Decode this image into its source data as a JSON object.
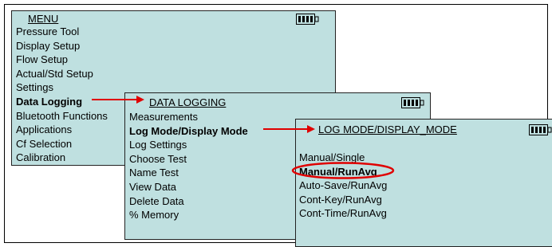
{
  "menu_main": {
    "title": "MENU",
    "items": [
      {
        "label": "Pressure Tool",
        "bold": false
      },
      {
        "label": "Display Setup",
        "bold": false
      },
      {
        "label": "Flow Setup",
        "bold": false
      },
      {
        "label": "Actual/Std Setup",
        "bold": false
      },
      {
        "label": "Settings",
        "bold": false
      },
      {
        "label": "Data Logging",
        "bold": true
      },
      {
        "label": "Bluetooth Functions",
        "bold": false
      },
      {
        "label": "Applications",
        "bold": false
      },
      {
        "label": "Cf Selection",
        "bold": false
      },
      {
        "label": "Calibration",
        "bold": false
      }
    ]
  },
  "menu_data_logging": {
    "title": "DATA LOGGING",
    "items": [
      {
        "label": "Measurements",
        "bold": false
      },
      {
        "label": "Log Mode/Display Mode",
        "bold": true
      },
      {
        "label": "Log Settings",
        "bold": false
      },
      {
        "label": "Choose Test",
        "bold": false
      },
      {
        "label": "Name Test",
        "bold": false
      },
      {
        "label": "View Data",
        "bold": false
      },
      {
        "label": "Delete Data",
        "bold": false
      },
      {
        "label": "% Memory",
        "bold": false
      }
    ]
  },
  "menu_log_mode": {
    "title": "LOG MODE/DISPLAY_MODE",
    "items": [
      {
        "label": "Manual/Single",
        "bold": false
      },
      {
        "label": "Manual/RunAvg",
        "bold": true,
        "circled": true
      },
      {
        "label": "Auto-Save/RunAvg",
        "bold": false
      },
      {
        "label": "Cont-Key/RunAvg",
        "bold": false
      },
      {
        "label": "Cont-Time/RunAvg",
        "bold": false
      }
    ]
  },
  "colors": {
    "panel_bg": "#bfe0e0",
    "arrow": "#e00000",
    "circle": "#e00000",
    "text": "#000000"
  },
  "icons": {
    "battery": "battery-full-icon",
    "arrow": "red-arrow-icon",
    "highlight": "red-ellipse-highlight"
  }
}
